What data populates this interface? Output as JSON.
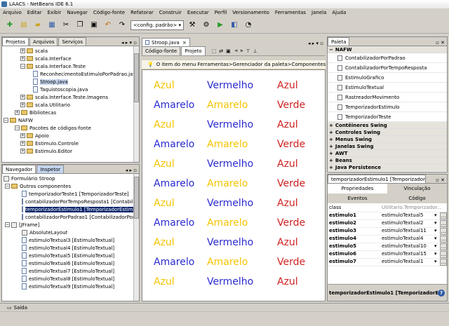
{
  "title": "LAACS - NetBeans IDE 6.1",
  "menu": [
    "Arquivo",
    "Editar",
    "Exibir",
    "Navegar",
    "Código-fonte",
    "Refatorar",
    "Construir",
    "Executar",
    "Perfil",
    "Versionamento",
    "Ferramentas",
    "Janela",
    "Ajuda"
  ],
  "toolbar": {
    "config_value": "<config. padrão>"
  },
  "left_top": {
    "tabs": [
      "Projetos",
      "Arquivos",
      "Serviços"
    ],
    "items": [
      {
        "label": "scala",
        "kind": "folder"
      },
      {
        "label": "scala.Interface",
        "kind": "folder"
      },
      {
        "label": "scala.Interface.Teste",
        "kind": "folder"
      },
      {
        "label": "ReconhecimentoEstimuloPorPadrao.java",
        "kind": "file"
      },
      {
        "label": "Stroop.java",
        "kind": "file"
      },
      {
        "label": "Taquistoscopia.java",
        "kind": "file"
      },
      {
        "label": "scala.Interface.Teste.Imagens",
        "kind": "folder"
      },
      {
        "label": "scala.Utilitario",
        "kind": "folder"
      },
      {
        "label": "Bibliotecas",
        "kind": "folder"
      },
      {
        "label": "NAFW",
        "kind": "folder"
      },
      {
        "label": "Pacotes de códigos-fonte",
        "kind": "folder"
      },
      {
        "label": "Apoio",
        "kind": "folder"
      },
      {
        "label": "Estimulo.Controle",
        "kind": "folder"
      },
      {
        "label": "Estimulo.Editor",
        "kind": "folder"
      }
    ]
  },
  "left_bottom": {
    "tabs": [
      "Navegador",
      "Inspetor"
    ],
    "items": [
      "Formulário Stroop",
      "Outros componentes",
      "temporizadorTeste1 [TemporizadorTeste]",
      "contabilizadorPorTempoResposta1 [Contabilizad",
      "temporizadorEstimulo1 [TemporizadorEstimulo]",
      "contabilizadorPorPadrao1 [ContabilizadorPorPad",
      "[JFrame]",
      "AbsoluteLayout",
      "estimuloTextual3 [EstimuloTextual]",
      "estimuloTextual4 [EstimuloTextual]",
      "estimuloTextual5 [EstimuloTextual]",
      "estimuloTextual6 [EstimuloTextual]",
      "estimuloTextual7 [EstimuloTextual]",
      "estimuloTextual8 [EstimuloTextual]",
      "estimuloTextual9 [EstimuloTextual]"
    ]
  },
  "editor": {
    "tab": "Stroop.java",
    "views": [
      "Código-fonte",
      "Projeto"
    ],
    "info": "O item do menu Ferramentas>Gerenciador da paleta>Componentes Swing/AWT"
  },
  "stroop": [
    [
      {
        "t": "Azul",
        "c": "#f5c400"
      },
      {
        "t": "Vermelho",
        "c": "#2a2ad0"
      },
      {
        "t": "Azul",
        "c": "#d02020"
      }
    ],
    [
      {
        "t": "Amarelo",
        "c": "#2a2ad0"
      },
      {
        "t": "Amarelo",
        "c": "#f5c400"
      },
      {
        "t": "Verde",
        "c": "#d02020"
      }
    ],
    [
      {
        "t": "Azul",
        "c": "#f5c400"
      },
      {
        "t": "Vermelho",
        "c": "#2a2ad0"
      },
      {
        "t": "Azul",
        "c": "#d02020"
      }
    ],
    [
      {
        "t": "Amarelo",
        "c": "#2a2ad0"
      },
      {
        "t": "Amarelo",
        "c": "#f5c400"
      },
      {
        "t": "Verde",
        "c": "#d02020"
      }
    ],
    [
      {
        "t": "Azul",
        "c": "#f5c400"
      },
      {
        "t": "Vermelho",
        "c": "#2a2ad0"
      },
      {
        "t": "Azul",
        "c": "#d02020"
      }
    ],
    [
      {
        "t": "Amarelo",
        "c": "#2a2ad0"
      },
      {
        "t": "Amarelo",
        "c": "#f5c400"
      },
      {
        "t": "Verde",
        "c": "#d02020"
      }
    ],
    [
      {
        "t": "Azul",
        "c": "#f5c400"
      },
      {
        "t": "Vermelho",
        "c": "#2a2ad0"
      },
      {
        "t": "Azul",
        "c": "#d02020"
      }
    ],
    [
      {
        "t": "Amarelo",
        "c": "#2a2ad0"
      },
      {
        "t": "Amarelo",
        "c": "#f5c400"
      },
      {
        "t": "Verde",
        "c": "#d02020"
      }
    ],
    [
      {
        "t": "Azul",
        "c": "#f5c400"
      },
      {
        "t": "Vermelho",
        "c": "#2a2ad0"
      },
      {
        "t": "Azul",
        "c": "#d02020"
      }
    ],
    [
      {
        "t": "Amarelo",
        "c": "#2a2ad0"
      },
      {
        "t": "Amarelo",
        "c": "#f5c400"
      },
      {
        "t": "Verde",
        "c": "#d02020"
      }
    ],
    [
      {
        "t": "Azul",
        "c": "#f5c400"
      },
      {
        "t": "Vermelho",
        "c": "#2a2ad0"
      },
      {
        "t": "Azul",
        "c": "#d02020"
      }
    ]
  ],
  "palette": {
    "title": "Paleta",
    "group": "NAFW",
    "items": [
      "ContabilizadorPorPadrao",
      "ContabilizadorPorTempoResposta",
      "EstimuloGrafico",
      "EstimuloTextual",
      "RastreadorMovimento",
      "TemporizadorEstimulo",
      "TemporizadorTeste"
    ],
    "categories": [
      "Contêineres Swing",
      "Controles Swing",
      "Menus Swing",
      "Janelas Swing",
      "AWT",
      "Beans",
      "Java Persistence"
    ]
  },
  "properties": {
    "title": "temporizadorEstimulo1 [TemporizadorEstim...",
    "tabs": [
      "Propriedades",
      "Vinculação",
      "Eventos",
      "Código"
    ],
    "rows": [
      {
        "k": "class",
        "v": "Utilitario.Temporizador..."
      },
      {
        "k": "estimulo1",
        "v": "estimuloTextual5"
      },
      {
        "k": "estimulo2",
        "v": "estimuloTextual2"
      },
      {
        "k": "estimulo3",
        "v": "estimuloTextual11"
      },
      {
        "k": "estimulo4",
        "v": "estimuloTextual4"
      },
      {
        "k": "estimulo5",
        "v": "estimuloTextual10"
      },
      {
        "k": "estimulo6",
        "v": "estimuloTextual15"
      },
      {
        "k": "estimulo7",
        "v": "estimuloTextual1"
      }
    ],
    "footer": "temporizadorEstimulo1 [TemporizadorEs..."
  },
  "status": "Saída"
}
